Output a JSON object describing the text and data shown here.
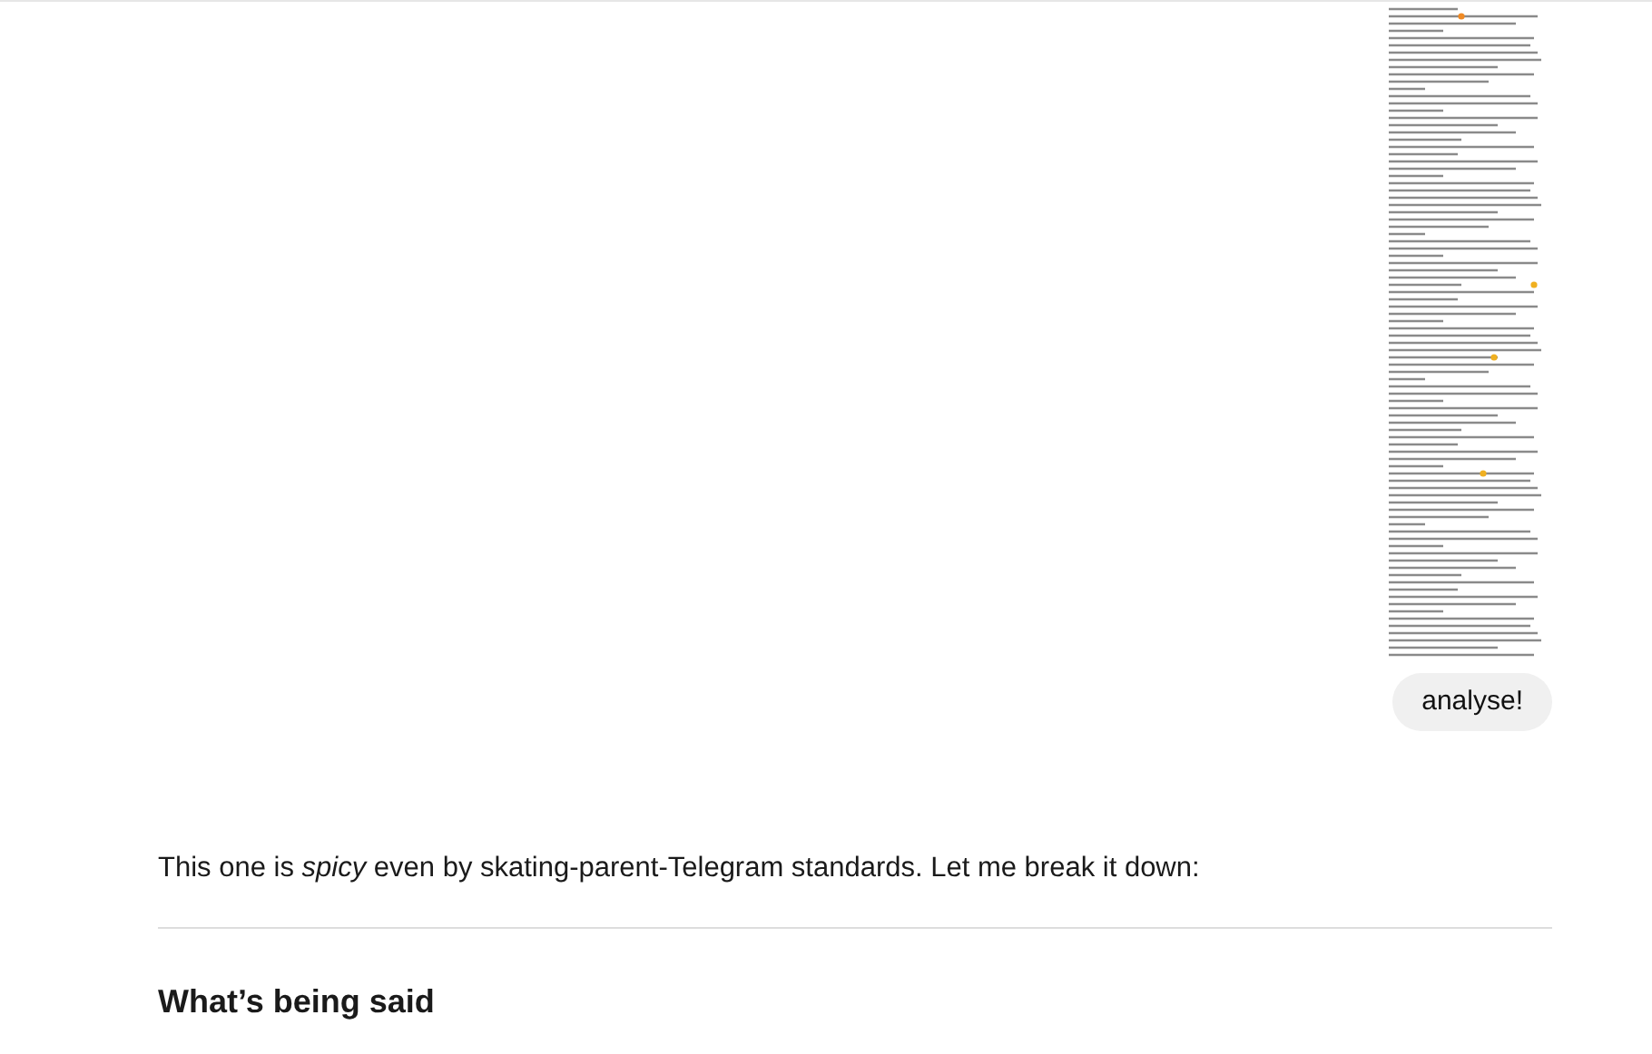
{
  "user_message": {
    "text": "analyse!"
  },
  "reply": {
    "intro": "This one is *spicy* even by skating-parent-Telegram standards. Let me break it down:",
    "heading": "What’s being said"
  }
}
